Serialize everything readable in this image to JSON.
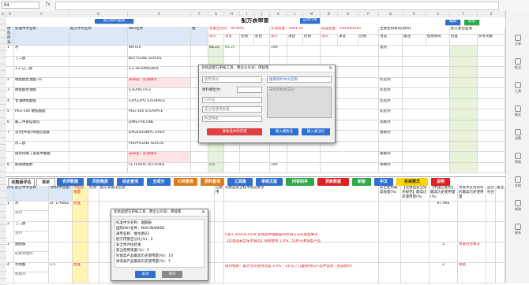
{
  "formula_bar": {
    "name_box": "R4",
    "fx": "fx"
  },
  "columns": [
    "A",
    "B",
    "C",
    "D",
    "E",
    "F",
    "G",
    "H",
    "I",
    "J",
    "K",
    "L",
    "M",
    "N",
    "O",
    "P",
    "Q",
    "R",
    "S",
    "T",
    "U",
    "V"
  ],
  "sheet1": {
    "title": "配方表审查",
    "top_button": "配方原料查找",
    "calc_button": "自动计算",
    "check_button": "编辑",
    "add_button": "新增",
    "headers": {
      "seq": "原料序号",
      "std_name": "标准中文名称",
      "alt_name": "配方中文名称",
      "inci": "INCI名称",
      "phase": "相",
      "pct_a": "含量百分比：99.99%",
      "pct_b": "实测含量：2001.01",
      "pct_c": "成品含量：100.000010",
      "func": "主要使用目的(原料)",
      "sub_in": "添入",
      "sub_c": "净含",
      "sub_p": "比例",
      "sub_f": "折合",
      "sub_u": "用途",
      "sub_note": "备注",
      "sub_reg": "使用目的",
      "sub_x": "检查",
      "ref": "参考文献",
      "other": "其他",
      "compl": "配方复合监测"
    },
    "rows": [
      {
        "n": "1",
        "std": "水",
        "alt": "",
        "inci": "WATER",
        "v1": "68.22",
        "v2": "68.22",
        "v3": "100",
        "v4": "",
        "func": "溶剂"
      },
      {
        "n": "",
        "std": "丁二醇",
        "alt": "",
        "inci": "BUTYLENE GLYCOL",
        "v1": "",
        "v2": "",
        "v3": "",
        "v4": "",
        "func": ""
      },
      {
        "n": "",
        "std": "1,2-己二醇",
        "alt": "",
        "inci": "1,2-HEXANEDIOL",
        "v1": "",
        "v2": "",
        "v3": "",
        "v4": "",
        "func": ""
      },
      {
        "n": "2",
        "std": "硬脂酸甘油酯-21",
        "alt": "",
        "inci": "未命名：必须填写",
        "v1": "",
        "v2": "",
        "v3": "",
        "v4": "",
        "func": "乳化剂"
      },
      {
        "n": "3",
        "std": "硬脂酸甘油酯",
        "alt": "",
        "inci": "STEARETH-2",
        "v1": "",
        "v2": "",
        "v3": "",
        "v4": "",
        "func": "乳化剂"
      },
      {
        "n": "4",
        "std": "甘油硬脂酸酯",
        "alt": "",
        "inci": "GLYCERYL STEARATE",
        "v1": "",
        "v2": "",
        "v3": "",
        "v4": "",
        "func": "乳化剂"
      },
      {
        "n": "5",
        "std": "PEG-100 硬脂酸酯",
        "alt": "",
        "inci": "PEG-100 STEARATE",
        "v1": "",
        "v2": "",
        "v3": "",
        "v4": "",
        "func": "乳化剂"
      },
      {
        "n": "6",
        "std": "聚二甲基硅氧烷",
        "alt": "",
        "inci": "DIMETHICONE",
        "v1": "",
        "v2": "",
        "v3": "",
        "v4": "",
        "func": "润肤剂"
      },
      {
        "n": "7",
        "std": "双(羟甲基)咪唑烷基脲",
        "alt": "",
        "inci": "DIAZOLIDINYL UREA",
        "v1": "",
        "v2": "",
        "v3": "",
        "v4": "",
        "func": "防腐剂"
      },
      {
        "n": "",
        "std": "丙二醇",
        "alt": "",
        "inci": "PROPYLENE GLYCOL",
        "v1": "",
        "v2": "",
        "v3": "",
        "v4": "",
        "func": ""
      },
      {
        "n": "",
        "std": "碘丙炔醇丁基氨甲酸酯",
        "alt": "",
        "inci": "未命名：必须填写",
        "v1": "",
        "v2": "",
        "v3": "",
        "v4": "",
        "func": "防腐剂"
      },
      {
        "n": "8",
        "std": "鲸蜡硬脂醇",
        "alt": "",
        "inci": "CETEARYL ALCOHOL",
        "v1": "0.5",
        "v2": "",
        "v3": "100",
        "v4": "",
        "func": "增稠剂"
      }
    ]
  },
  "toolbar": {
    "items": [
      {
        "label": "完整版评估",
        "color": "#ffffff",
        "text": "#333333"
      },
      {
        "label": "清单",
        "color": "#ffffff",
        "text": "#333333"
      },
      {
        "label": "安评数据",
        "color": "#2f6fd0",
        "text": "#ffffff"
      },
      {
        "label": "风险物质",
        "color": "#2f6fd0",
        "text": "#ffffff"
      },
      {
        "label": "综合查询",
        "color": "#2f6fd0",
        "text": "#ffffff"
      },
      {
        "label": "全成分",
        "color": "#2f6fd0",
        "text": "#ffffff"
      },
      {
        "label": "CIR查询",
        "color": "#e07b1a",
        "text": "#ffffff"
      },
      {
        "label": "原料查询",
        "color": "#e07b1a",
        "text": "#ffffff"
      },
      {
        "label": "工具箱",
        "color": "#2f6fd0",
        "text": "#ffffff"
      },
      {
        "label": "审核文案",
        "color": "#2f6fd0",
        "text": "#ffffff"
      },
      {
        "label": "问答助手",
        "color": "#2ea84a",
        "text": "#ffffff"
      },
      {
        "label": "更新数据",
        "color": "#e02020",
        "text": "#ffffff"
      },
      {
        "label": "新版",
        "color": "#2ea84a",
        "text": "#ffffff"
      },
      {
        "label": "中文",
        "color": "#2f6fd0",
        "text": "#ffffff"
      },
      {
        "label": "权威模式",
        "color": "#ffd400",
        "text": "#333333"
      },
      {
        "label": "说明",
        "color": "#e02020",
        "text": "#ffffff"
      }
    ]
  },
  "sheet2": {
    "headers": {
      "seq": "序号",
      "name": "配方中文名称",
      "pct": "(原料中含量)",
      "limit": "不超过限量",
      "note": "检测",
      "desc": "配方表备注信息",
      "status": "已使用",
      "rules": "化妆品安全技术规范要求",
      "col_a": "安全使用最高限量(%)",
      "col_b": "【化妆品安全技术规范】最高历史使用量(%)",
      "col_c": "【中国已使用】最高历史使用量(%)",
      "col_d": "有技术支持资料的最高历史使用量",
      "col_e": "是否符合",
      "col_f": "备注"
    },
    "rows": [
      {
        "n": "1",
        "name": "水",
        "sub": "溶剂",
        "code": "ZF 179042",
        "mark": "批准",
        "val": "97.966"
      },
      {
        "n": "2",
        "name": "丁二醇",
        "sub": "溶剂",
        "code": "",
        "mark": "",
        "val": ""
      },
      {
        "n": "3",
        "name": "烟酰胺",
        "sub": "皮肤调理剂",
        "code": "",
        "mark": "",
        "val": "5",
        "remark": "用量符合要求"
      },
      {
        "n": "4",
        "name": "水杨酸",
        "sub": "防腐剂",
        "code": "1.5",
        "mark": "批准",
        "val": "2",
        "remark": "限量"
      }
    ],
    "rule_text_1": "GB/T 35914-2018 化妆品中烟酰胺的检测方法及限量要求",
    "rule_text_2": "【化妆品安全技术规范】限制使用 1.0%，仅用于淋洗类产品",
    "rule_text_3": "限用物质：最大允许使用浓度 3.0%；3岁以下儿童使用的产品中禁用（香波除外）"
  },
  "dialog1": {
    "title": "化妆品配方审核工具 - 政企公众号：审核帮",
    "field1": "使用目的",
    "field2": "搜索原料中文名称",
    "label_phase": "原料相位为：",
    "result_label": "未找到相关成分",
    "field3": "CAS号",
    "field4": "安全性使用限量",
    "field5": "色谱种类",
    "btn_clear": "清除选中的内容",
    "btn_input": "输入模板名",
    "btn_input2": "输入备注栏"
  },
  "dialog2": {
    "title": "化妆品配方审核工具 - 政企公众号：审核帮",
    "line1": "标准中文名称：烟酰胺",
    "line2": "国际INCI名称：NIACINAMIDE",
    "line3": "通用名称：维生素B3",
    "line4": "配方用量百分比(%)：2",
    "line5": "安全性评估结果：",
    "line6": "安全使用限量(%)：5",
    "line7": "驻留类产品最高历史使用量(%)：10",
    "line8": "淋洗类产品最高历史使用量(%)：5",
    "btn1": "查询",
    "btn2": "关闭"
  },
  "right_panel": [
    {
      "label": "分享",
      "icon": "share-icon"
    },
    {
      "label": "批注",
      "icon": "comment-icon"
    },
    {
      "label": "工具",
      "icon": "tool-icon"
    },
    {
      "label": "格式",
      "icon": "format-icon"
    },
    {
      "label": "设置",
      "icon": "gear-icon"
    },
    {
      "label": "帮助",
      "icon": "help-icon"
    },
    {
      "label": "文档",
      "icon": "document-icon"
    },
    {
      "label": "新增",
      "icon": "plus-icon"
    },
    {
      "label": "更多",
      "icon": "more-icon"
    }
  ]
}
